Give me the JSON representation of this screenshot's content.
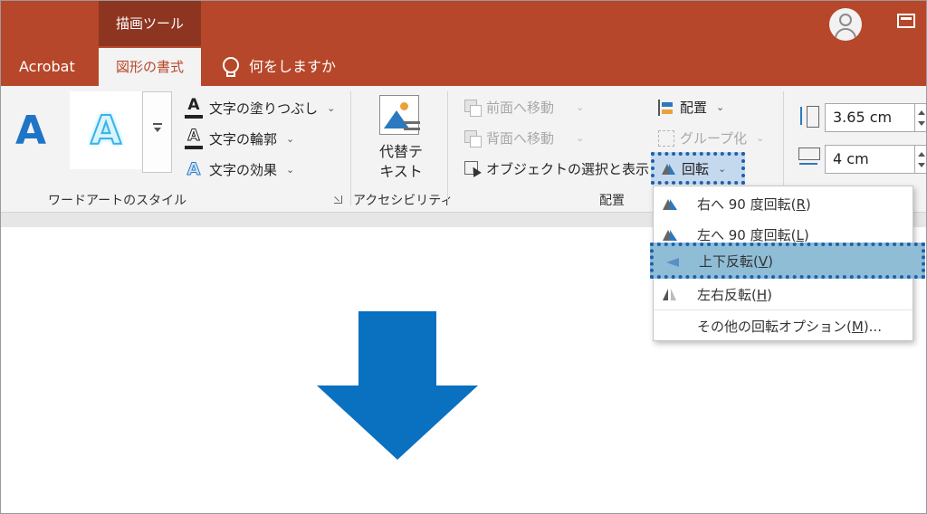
{
  "titlebar": {
    "context_group": "描画ツール",
    "tabs": [
      {
        "label": "Acrobat"
      },
      {
        "label": "図形の書式"
      },
      {
        "label": "何をしますか"
      }
    ]
  },
  "ribbon": {
    "wordart": {
      "group_label": "ワードアートのスタイル",
      "sample_text": "A",
      "commands": [
        {
          "label": "文字の塗りつぶし"
        },
        {
          "label": "文字の輪郭"
        },
        {
          "label": "文字の効果"
        }
      ]
    },
    "accessibility": {
      "group_label": "アクセシビリティ",
      "alt_text_line1": "代替テ",
      "alt_text_line2": "キスト"
    },
    "arrange": {
      "group_label": "配置",
      "bring_forward": "前面へ移動",
      "send_backward": "背面へ移動",
      "selection_pane": "オブジェクトの選択と表示",
      "align": "配置",
      "group": "グループ化",
      "rotate": "回転"
    },
    "size": {
      "height_value": "3.65 cm",
      "width_value": "4 cm"
    }
  },
  "rotate_menu": {
    "items": [
      {
        "label": "右へ 90 度回転(",
        "key": "R",
        "suffix": ")",
        "highlighted": false
      },
      {
        "label": "左へ 90 度回転(",
        "key": "L",
        "suffix": ")",
        "highlighted": false
      },
      {
        "label": "上下反転(",
        "key": "V",
        "suffix": ")",
        "highlighted": true
      },
      {
        "label": "左右反転(",
        "key": "H",
        "suffix": ")",
        "highlighted": false
      },
      {
        "label": "その他の回転オプション(",
        "key": "M",
        "suffix": ")..."
      }
    ]
  },
  "colors": {
    "title_bar": "#b7472a",
    "ribbon_bg": "#f3f3f3",
    "shape_fill": "#0a70c0",
    "highlight": "#8fbdd6",
    "focus_dots": "#1d61ad"
  }
}
